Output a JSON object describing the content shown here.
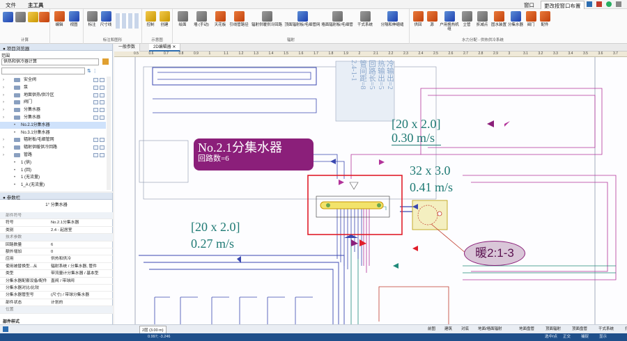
{
  "menubar": {
    "items": [
      "文件",
      "主工具"
    ],
    "right": [
      "窗口",
      "更改按窗口布置"
    ]
  },
  "ribbon": {
    "groups": [
      {
        "label": "计算",
        "tools": []
      },
      {
        "label": "",
        "tools": [
          "编辑",
          "视图"
        ]
      },
      {
        "label": "标注和图形",
        "tools": [
          "标注",
          "尺寸线"
        ]
      },
      {
        "label": "示意图",
        "tools": [
          "控制",
          "创建"
        ]
      },
      {
        "label": "辐射",
        "tools": [
          "绘面",
          "墙 (手动)",
          "天花板",
          "引线管路径",
          "辐射供暖供冷回路",
          "顶面辐射板/毛细管网",
          "墙面辐射板/毛细管",
          "干式系统",
          "分隔和伸缩缝"
        ]
      },
      {
        "label": "水力分配 - 供热供冷系统",
        "tools": [
          "供回",
          "源",
          "户用换热机组",
          "立管",
          "折减点",
          "固水装置",
          "分集水器",
          "阀门",
          "配件"
        ]
      }
    ]
  },
  "project_browser": {
    "title": "● 项目浏览器",
    "scope_label": "范围",
    "scope_value": "供热和供冷器计算",
    "items": [
      {
        "label": "安全阀",
        "level": 0
      },
      {
        "label": "泵",
        "level": 0
      },
      {
        "label": "地面供热/供冷区",
        "level": 0
      },
      {
        "label": "阀门",
        "level": 0
      },
      {
        "label": "分集水器",
        "level": 0
      },
      {
        "label": "分集水器",
        "level": 0
      },
      {
        "label": "No.2.1分集水器",
        "level": 1,
        "selected": true
      },
      {
        "label": "No.3.1分集水器",
        "level": 1
      },
      {
        "label": "辐射板/毛细管网",
        "level": 0
      },
      {
        "label": "辐射供暖供冷回路",
        "level": 0
      },
      {
        "label": "管路",
        "level": 0
      },
      {
        "label": "1 (供)",
        "level": 1
      },
      {
        "label": "1 (回)",
        "level": 1
      },
      {
        "label": "1 (无流量)",
        "level": 1
      },
      {
        "label": "1_A (无流量)",
        "level": 1
      }
    ]
  },
  "params": {
    "title": "● 参数栏",
    "type_name": "1° 分集水器",
    "rows": [
      {
        "k": "部件符号",
        "v": "",
        "cat": true
      },
      {
        "k": "符号",
        "v": "No.2.1分集水器"
      },
      {
        "k": "类别",
        "v": "2.4 - 起居室"
      },
      {
        "k": "技术参数",
        "v": "",
        "cat": true
      },
      {
        "k": "回路数量",
        "v": "6"
      },
      {
        "k": "额外增加",
        "v": "0"
      },
      {
        "k": "应用",
        "v": "供热和供冷"
      },
      {
        "k": "使用被替换型...从",
        "v": "辐射系统 / 分集水器, 管件"
      },
      {
        "k": "类型",
        "v": "带流量计分集水器 / 基本型"
      },
      {
        "k": "分集水器配套设备/配件",
        "v": "直阀 / 带球阀"
      },
      {
        "k": "分集水器对比/比较",
        "v": ""
      },
      {
        "k": "分集水器管型号",
        "v": "(尺寸) / 带球分集水器"
      },
      {
        "k": "部件状态",
        "v": "计划的"
      },
      {
        "k": "位置",
        "v": "",
        "cat": true
      }
    ],
    "footer": "部件样式"
  },
  "tabs": [
    "一般参数",
    "2D编辑器"
  ],
  "ruler": [
    "0.5",
    "0.6",
    "0.7",
    "0.8",
    "0.9",
    "1",
    "1.1",
    "1.2",
    "1.3",
    "1.4",
    "1.5",
    "1.6",
    "1.7",
    "1.8",
    "1.9",
    "2",
    "2.1",
    "2.2",
    "2.3",
    "2.4",
    "2.5",
    "2.6",
    "2.7",
    "2.8",
    "2.9",
    "3",
    "3.1",
    "3.2",
    "3.3",
    "3.4",
    "3.5",
    "3.6",
    "3.7"
  ],
  "canvas": {
    "manifold_name": "No.2.1分集水器",
    "circuit_count": "回路数=6",
    "vertical_note": [
      "冷输出=2",
      "热输出=5",
      "回路长=5",
      "管间距=8",
      "2.4-1-1"
    ],
    "pipe1": {
      "size": "[20 x 2.0]",
      "velocity": "0.30 m/s"
    },
    "pipe2": {
      "size": "32 x 3.0",
      "velocity": "0.41 m/s"
    },
    "pipe3": {
      "size": "[20 x 2.0]",
      "velocity": "0.27 m/s"
    },
    "bubble": "暖2:1-3"
  },
  "status": {
    "floor": "2层 (3.00 m)",
    "coords": "0.997; -3.246",
    "layers": [
      "前图",
      "建筑",
      "对底",
      "地面/墙面辐射",
      "地面盘管",
      "顶面辐射",
      "顶面盘管",
      "干式系统",
      "打印"
    ],
    "right": [
      "选中/点",
      "正交",
      "捕捉",
      "显示"
    ]
  },
  "colors": {
    "accent": "#2b6cb0",
    "magenta": "#8b1f7a",
    "teal": "#1f7a74",
    "blue": "#2c3a9e",
    "red": "#e11d2a",
    "yellow": "#f2e36b"
  }
}
